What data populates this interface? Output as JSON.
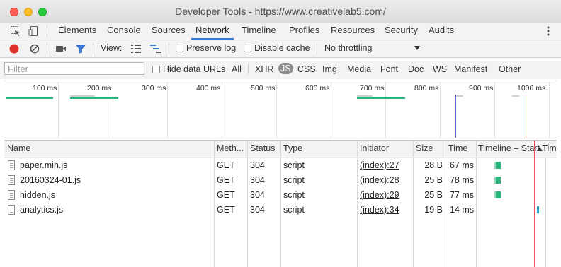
{
  "window": {
    "title": "Developer Tools - https://www.creativelab5.com/"
  },
  "tabs": [
    "Elements",
    "Console",
    "Sources",
    "Network",
    "Timeline",
    "Profiles",
    "Resources",
    "Security",
    "Audits"
  ],
  "active_tab": "Network",
  "toolbar": {
    "view_label": "View:",
    "preserve_log": "Preserve log",
    "disable_cache": "Disable cache",
    "throttling": "No throttling"
  },
  "filter": {
    "placeholder": "Filter",
    "hide_data_urls": "Hide data URLs",
    "types": [
      "All",
      "XHR",
      "JS",
      "CSS",
      "Img",
      "Media",
      "Font",
      "Doc",
      "WS",
      "Manifest",
      "Other"
    ],
    "selected_type": "JS"
  },
  "overview": {
    "ticks": [
      "100 ms",
      "200 ms",
      "300 ms",
      "400 ms",
      "500 ms",
      "600 ms",
      "700 ms",
      "800 ms",
      "900 ms",
      "1000 ms"
    ]
  },
  "table": {
    "columns": [
      "Name",
      "Meth...",
      "Status",
      "Type",
      "Initiator",
      "Size",
      "Time",
      "Timeline – Start Time"
    ],
    "rows": [
      {
        "name": "paper.min.js",
        "method": "GET",
        "status": "304",
        "type": "script",
        "initiator": "(index):27",
        "size": "28 B",
        "time": "67 ms"
      },
      {
        "name": "20160324-01.js",
        "method": "GET",
        "status": "304",
        "type": "script",
        "initiator": "(index):28",
        "size": "25 B",
        "time": "78 ms"
      },
      {
        "name": "hidden.js",
        "method": "GET",
        "status": "304",
        "type": "script",
        "initiator": "(index):29",
        "size": "25 B",
        "time": "77 ms"
      },
      {
        "name": "analytics.js",
        "method": "GET",
        "status": "304",
        "type": "script",
        "initiator": "(index):34",
        "size": "19 B",
        "time": "14 ms"
      }
    ]
  },
  "colors": {
    "accent": "#3879d9",
    "waiting_bar": "#28b47a",
    "download_bar": "#1fa6c8",
    "load_line": "#e05555",
    "dom_line": "#5865d6"
  }
}
